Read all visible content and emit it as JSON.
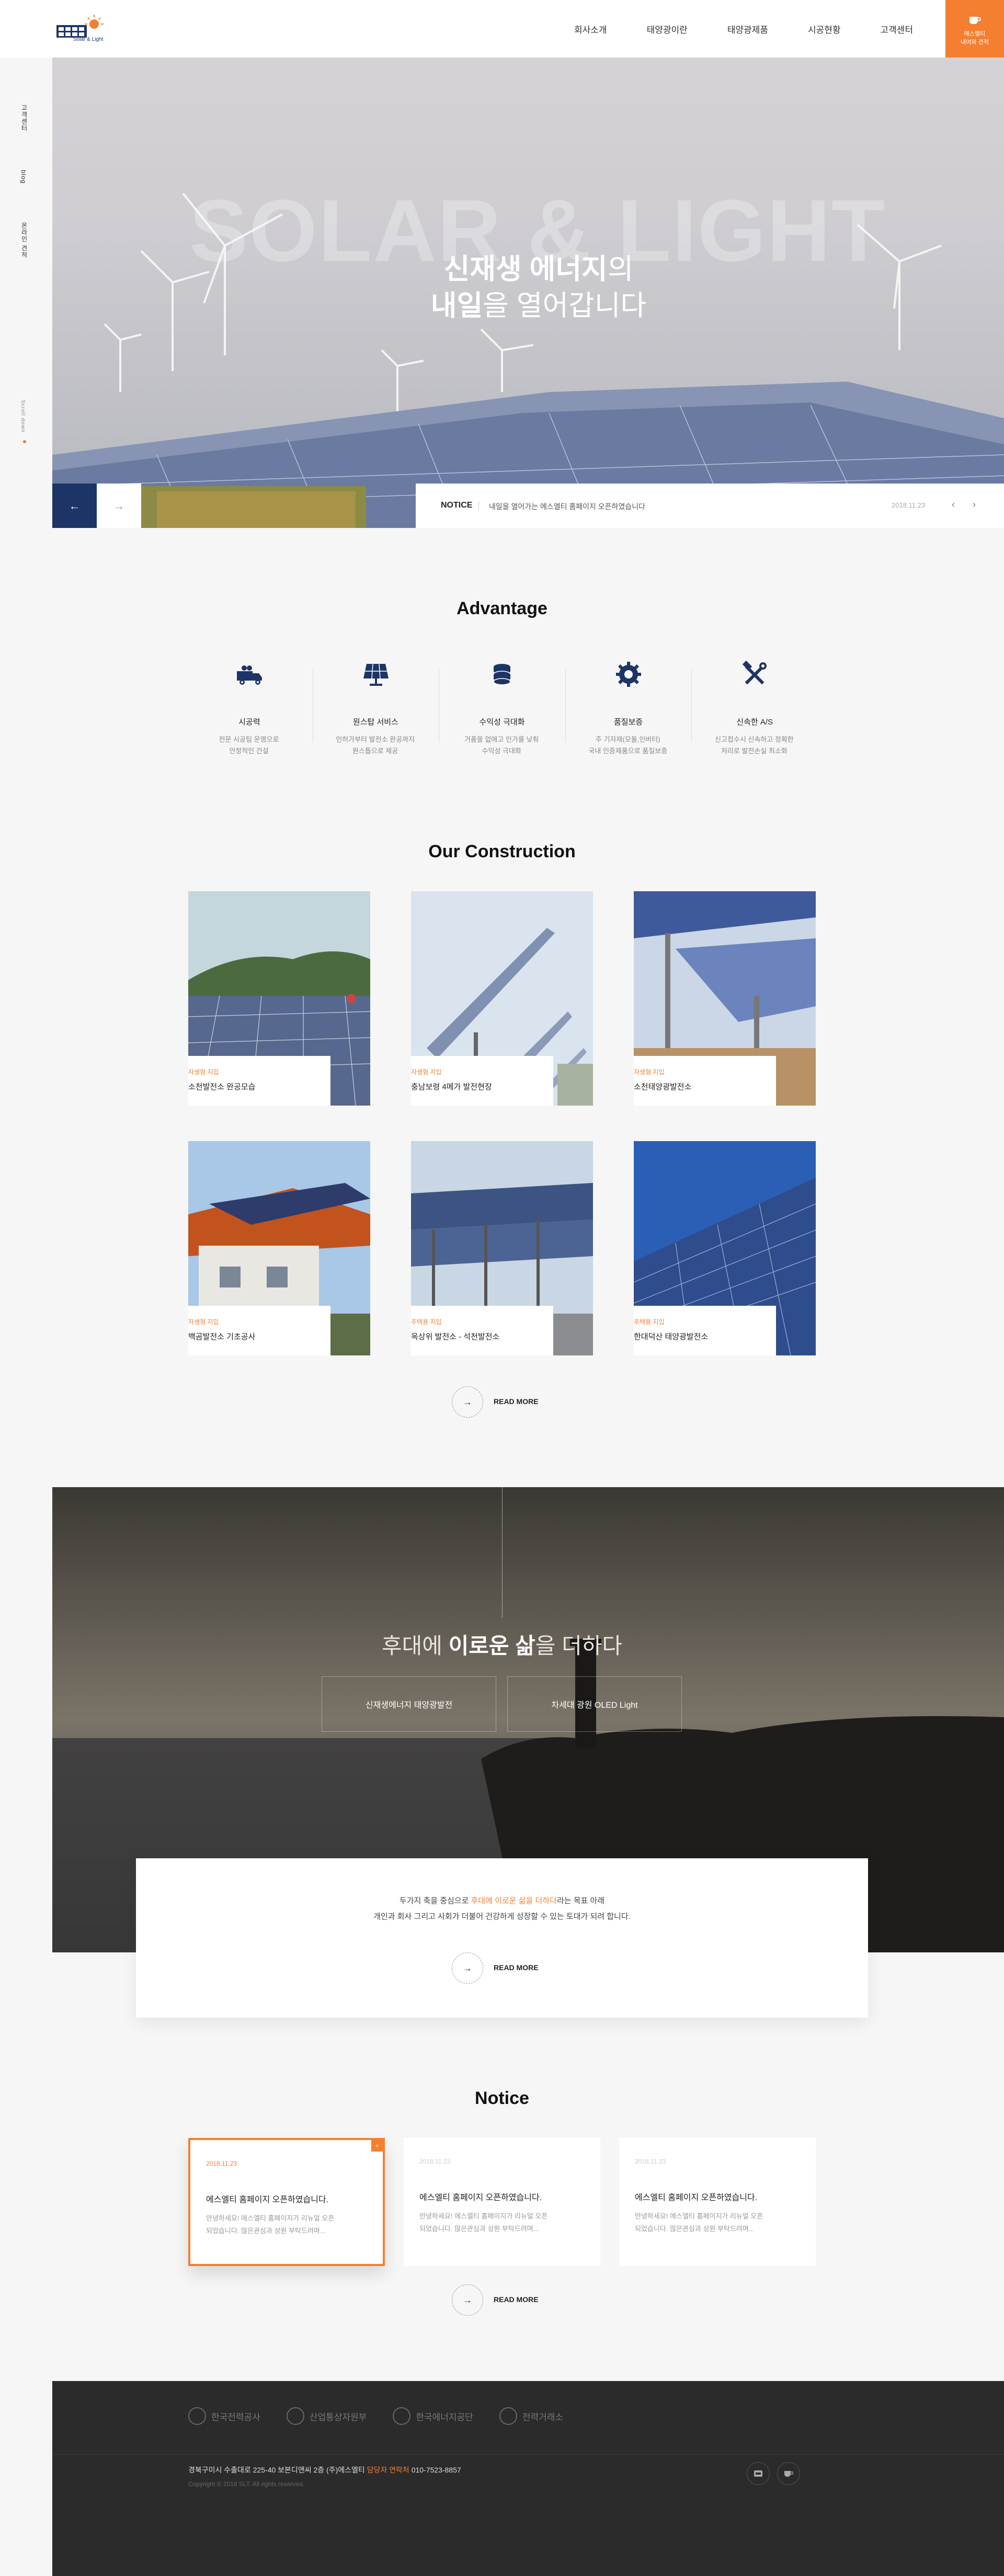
{
  "header": {
    "logo_text": "Solar & Light",
    "nav": [
      "회사소개",
      "태양광이란",
      "태양광제품",
      "시공현황",
      "고객센터"
    ],
    "cta_line1": "에스엘티",
    "cta_line2": "내여와 견적"
  },
  "side": {
    "items": [
      "고객센터",
      "blog",
      "온라인 견적"
    ],
    "scroll_label": "Scroll down"
  },
  "hero": {
    "big_text": "SOLAR & LIGHT",
    "title1_bold": "신재생 에너지",
    "title1_rest": "의",
    "title2_bold": "내일",
    "title2_rest": "을 열어갑니다",
    "prev_icon": "arrow-left-icon",
    "next_icon": "arrow-right-icon"
  },
  "notice_bar": {
    "label": "NOTICE",
    "text": "내일을 열어가는 에스엘티 홈페이지 오픈하였습니다",
    "date": "2018.11.23"
  },
  "advantage": {
    "title": "Advantage",
    "items": [
      {
        "icon": "truck-icon",
        "name": "시공력",
        "desc1": "전문 시공팀 운영으로",
        "desc2": "안정적인 건설"
      },
      {
        "icon": "solar-panel-icon",
        "name": "원스탑 서비스",
        "desc1": "인허가부터 발전소 완공까지",
        "desc2": "원스톱으로 제공"
      },
      {
        "icon": "coins-icon",
        "name": "수익성 극대화",
        "desc1": "거품을 없애고 인가를 낮춰",
        "desc2": "수익성 극대화"
      },
      {
        "icon": "gear-icon",
        "name": "품질보증",
        "desc1": "주 기자재(모듈,인버터)",
        "desc2": "국내 인증제품으로 품질보증"
      },
      {
        "icon": "tools-icon",
        "name": "신속한 A/S",
        "desc1": "신고접수시 신속하고 정확한",
        "desc2": "처리로 발전손실 최소화"
      }
    ]
  },
  "construction": {
    "title": "Our Construction",
    "items": [
      {
        "cat": "자생형 지입",
        "title": "소천발전소 완공모습"
      },
      {
        "cat": "자생형 지입",
        "title": "충남보령 4메가 발전현장"
      },
      {
        "cat": "자생형 지입",
        "title": "소천태양광발전소"
      },
      {
        "cat": "자생형 지입",
        "title": "백곰발전소 기초공사"
      },
      {
        "cat": "주택용 지입",
        "title": "옥상위 발전소 - 석천발전소"
      },
      {
        "cat": "주택용 지입",
        "title": "한대덕산 태양광발전소"
      }
    ],
    "more": "READ MORE"
  },
  "promo": {
    "title_pre": "후대에 ",
    "title_bold": "이로운 삶",
    "title_post": "을 더하다",
    "btn1": "신재생에너지 태양광발전",
    "btn2": "차세대 광원 OLED Light",
    "line1_pre": "두가지 축을 중심으로 ",
    "line1_hl": "후대에 이로운 삶을 더하다",
    "line1_post": "라는 목표 아래",
    "line2": "개인과 회사 그리고 사회가 더불어 건강하게 성장할 수 있는 토대가 되려 합니다.",
    "more": "READ MORE"
  },
  "notice": {
    "title": "Notice",
    "items": [
      {
        "date": "2018.11.23",
        "title": "에스엘티 홈페이지 오픈하였습니다.",
        "body1": "안녕하세요! 에스엘티 홈페이지가 리뉴얼 오픈",
        "body2": "되었습니다. 많은관심과 성원 부탁드려며..."
      },
      {
        "date": "2018.11.23",
        "title": "에스엘티 홈페이지 오픈하였습니다.",
        "body1": "안녕하세요! 에스엘티 홈페이지가 리뉴얼 오픈",
        "body2": "되었습니다. 많은관심과 성원 부탁드려며..."
      },
      {
        "date": "2018.11.23",
        "title": "에스엘티 홈페이지 오픈하였습니다.",
        "body1": "안녕하세요! 에스엘티 홈페이지가 리뉴얼 오픈",
        "body2": "되었습니다. 많은관심과 성원 부탁드려며..."
      }
    ],
    "more": "READ MORE"
  },
  "footer": {
    "logos": [
      "한국전력공사",
      "산업통상자원부",
      "한국에너지공단",
      "전력거래소"
    ],
    "addr_pre": "경북구미시 수출대로 225-40 보본디앤씨 2층 (주)에스엘티 ",
    "addr_hl": "담당자 연락처",
    "addr_post": " 010-7523-8857",
    "copyright": "Copyright © 2018 SLT. All rights reserved."
  },
  "colors": {
    "accent": "#f47f30",
    "navy": "#1d3566",
    "footer": "#2b2b2b"
  }
}
